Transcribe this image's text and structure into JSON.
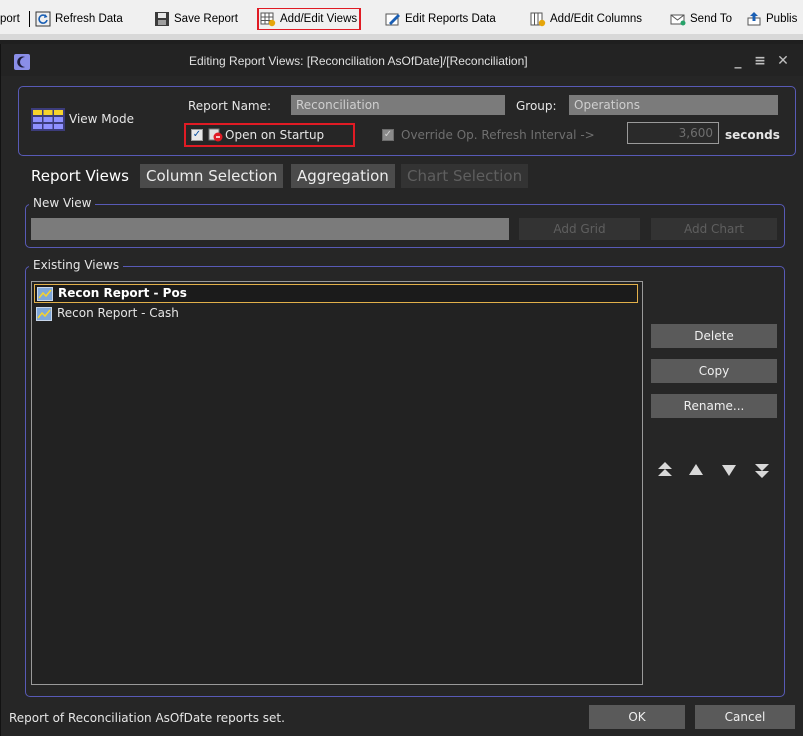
{
  "toolbar": {
    "partial_label": "port",
    "refresh": "Refresh Data",
    "save": "Save Report",
    "add_edit_views": "Add/Edit Views",
    "edit_reports": "Edit Reports Data",
    "add_edit_columns": "Add/Edit Columns",
    "send_to": "Send To",
    "publish": "Publis"
  },
  "dialog": {
    "title": "Editing Report Views: [Reconciliation AsOfDate]/[Reconciliation]",
    "view_mode_label": "View Mode",
    "report_name_label": "Report Name:",
    "report_name_value": "Reconciliation",
    "group_label": "Group:",
    "group_value": "Operations",
    "open_on_startup_label": "Open on Startup",
    "open_on_startup_checked": true,
    "override_label": "Override Op. Refresh Interval ->",
    "override_checked": true,
    "interval_value": "3,600",
    "seconds_label": "seconds"
  },
  "tabs": [
    {
      "label": "Report Views",
      "state": "active"
    },
    {
      "label": "Column Selection",
      "state": "normal"
    },
    {
      "label": "Aggregation",
      "state": "normal"
    },
    {
      "label": "Chart Selection",
      "state": "disabled"
    }
  ],
  "new_view": {
    "legend": "New View",
    "input_value": "",
    "add_grid_label": "Add Grid",
    "add_chart_label": "Add Chart"
  },
  "existing_views": {
    "legend": "Existing Views",
    "items": [
      {
        "label": "Recon Report - Pos",
        "selected": true
      },
      {
        "label": "Recon Report - Cash",
        "selected": false
      }
    ],
    "delete_label": "Delete",
    "copy_label": "Copy",
    "rename_label": "Rename..."
  },
  "footer": {
    "status": "Report of Reconciliation AsOfDate reports set.",
    "ok_label": "OK",
    "cancel_label": "Cancel"
  },
  "colors": {
    "highlight_red": "#e01b24",
    "group_border": "#585ab6",
    "selection_border": "#e2b04a",
    "dialog_bg": "#262626"
  }
}
